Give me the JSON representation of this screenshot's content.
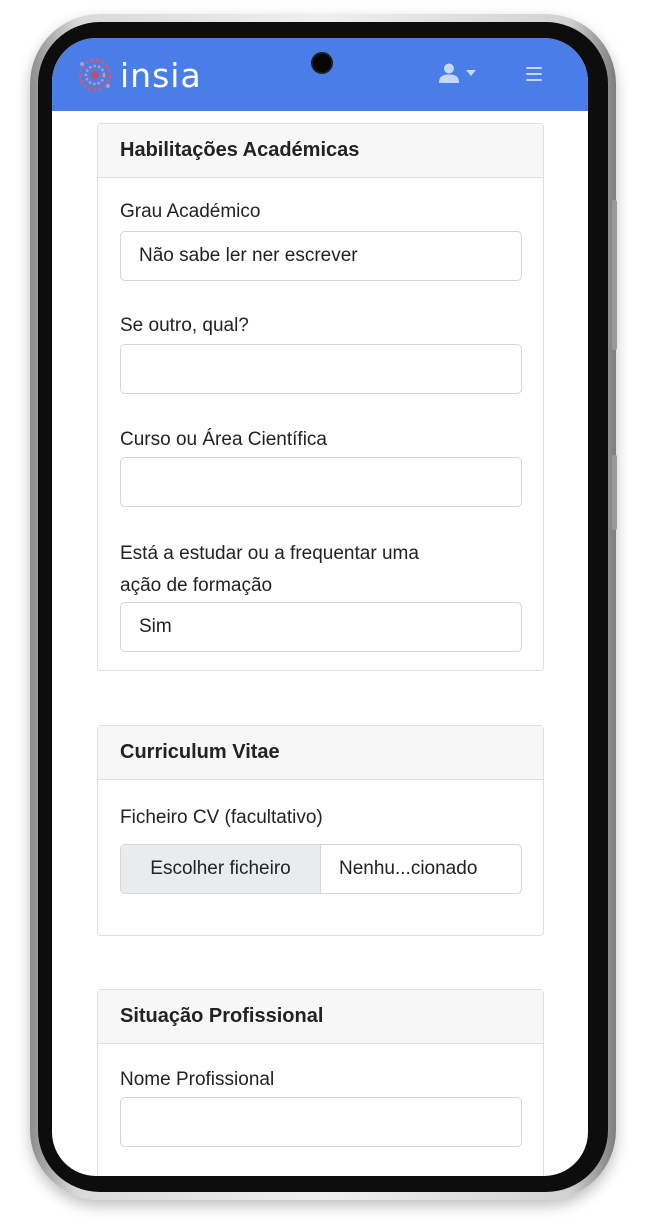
{
  "app": {
    "brand": "insia"
  },
  "icons": {
    "logo": "insia-logo-icon",
    "user": "user-icon",
    "caret": "chevron-down-icon",
    "menu": "hamburger-menu-icon"
  },
  "colors": {
    "navbar": "#4a7de8",
    "logo_accent": "#d15b6a"
  },
  "sections": {
    "academic": {
      "title": "Habilitações Académicas",
      "degree_label": "Grau Académico",
      "degree_value": "Não sabe ler ner escrever",
      "other_label": "Se outro, qual?",
      "other_value": "",
      "course_label": "Curso ou Área Científica",
      "course_value": "",
      "studying_label_line1": "Está a estudar ou a frequentar uma",
      "studying_label_line2": "ação de formação",
      "studying_value": "Sim"
    },
    "cv": {
      "title": "Curriculum Vitae",
      "file_label": "Ficheiro CV (facultativo)",
      "file_button": "Escolher ficheiro",
      "file_status": "Nenhu...cionado"
    },
    "professional": {
      "title": "Situação Profissional",
      "name_label": "Nome Profissional",
      "name_value": ""
    }
  }
}
